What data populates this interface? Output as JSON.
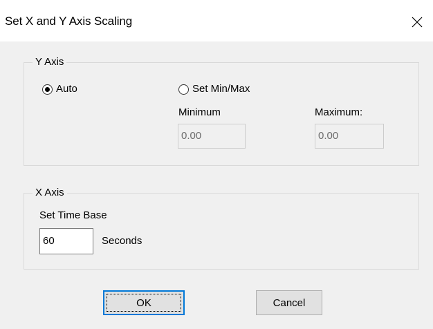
{
  "window": {
    "title": "Set X and Y Axis Scaling",
    "close_icon": "close-icon"
  },
  "y_axis": {
    "group_label": "Y Axis",
    "auto_label": "Auto",
    "auto_selected": true,
    "set_minmax_label": "Set Min/Max",
    "set_minmax_selected": false,
    "minimum_label": "Minimum",
    "maximum_label": "Maximum:",
    "minimum_value": "0.00",
    "maximum_value": "0.00"
  },
  "x_axis": {
    "group_label": "X Axis",
    "time_base_label": "Set Time Base",
    "time_base_value": "60",
    "unit_label": "Seconds"
  },
  "buttons": {
    "ok_label": "OK",
    "cancel_label": "Cancel"
  }
}
